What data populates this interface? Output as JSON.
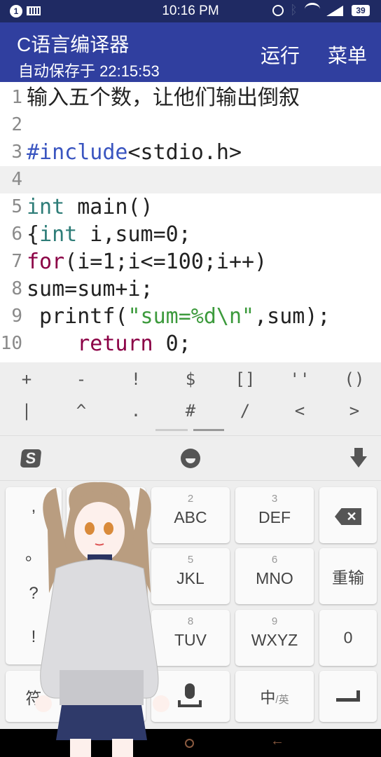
{
  "status_bar": {
    "notification_count": "1",
    "time": "10:16 PM",
    "battery": "39"
  },
  "app_bar": {
    "title": "C语言编译器",
    "subtitle": "自动保存于 22:15:53",
    "run_label": "运行",
    "menu_label": "菜单",
    "color": "#303f9f"
  },
  "editor": {
    "highlighted_line": 4,
    "lines": [
      {
        "n": "1",
        "segs": [
          {
            "t": "输入五个数，让他们输出倒叙",
            "k": "cmt"
          }
        ]
      },
      {
        "n": "2",
        "segs": []
      },
      {
        "n": "3",
        "segs": [
          {
            "t": "#include",
            "k": "pre"
          },
          {
            "t": "<stdio.h>",
            "k": ""
          }
        ]
      },
      {
        "n": "4",
        "segs": []
      },
      {
        "n": "5",
        "segs": [
          {
            "t": "int",
            "k": "type"
          },
          {
            "t": " main()",
            "k": ""
          }
        ]
      },
      {
        "n": "6",
        "segs": [
          {
            "t": "{",
            "k": ""
          },
          {
            "t": "int",
            "k": "type"
          },
          {
            "t": " i,sum=0;",
            "k": ""
          }
        ]
      },
      {
        "n": "7",
        "segs": [
          {
            "t": "for",
            "k": "ctrl"
          },
          {
            "t": "(i=1;i<=100;i++)",
            "k": ""
          }
        ]
      },
      {
        "n": "8",
        "segs": [
          {
            "t": "sum=sum+i;",
            "k": ""
          }
        ]
      },
      {
        "n": "9",
        "segs": [
          {
            "t": " printf(",
            "k": ""
          },
          {
            "t": "\"sum=%d\\n\"",
            "k": "str"
          },
          {
            "t": ",sum);",
            "k": ""
          }
        ]
      },
      {
        "n": "10",
        "segs": [
          {
            "t": "    ",
            "k": ""
          },
          {
            "t": "return",
            "k": "ctrl"
          },
          {
            "t": " 0;",
            "k": ""
          }
        ]
      }
    ]
  },
  "symbols": {
    "row1": [
      "+",
      "-",
      "!",
      "$",
      "[]",
      "''",
      "()"
    ],
    "row2": [
      "|",
      "^",
      ".",
      "#",
      "/",
      "<",
      ">"
    ]
  },
  "keyboard": {
    "toolbar": {
      "logo_icon": "sogou-logo",
      "emoji_icon": "emoji-icon",
      "hide_icon": "arrow-down-icon"
    },
    "punct": [
      ",",
      "。",
      "?",
      "!"
    ],
    "keys": [
      {
        "num": "2",
        "letters": "ABC"
      },
      {
        "num": "3",
        "letters": "DEF"
      },
      {
        "num": "5",
        "letters": "JKL"
      },
      {
        "num": "6",
        "letters": "MNO"
      },
      {
        "num": "8",
        "letters": "TUV"
      },
      {
        "num": "9",
        "letters": "WXYZ"
      }
    ],
    "reinput": "重输",
    "zero": "0",
    "symbol_key": "符",
    "lang_main": "中",
    "lang_alt": "/英"
  }
}
